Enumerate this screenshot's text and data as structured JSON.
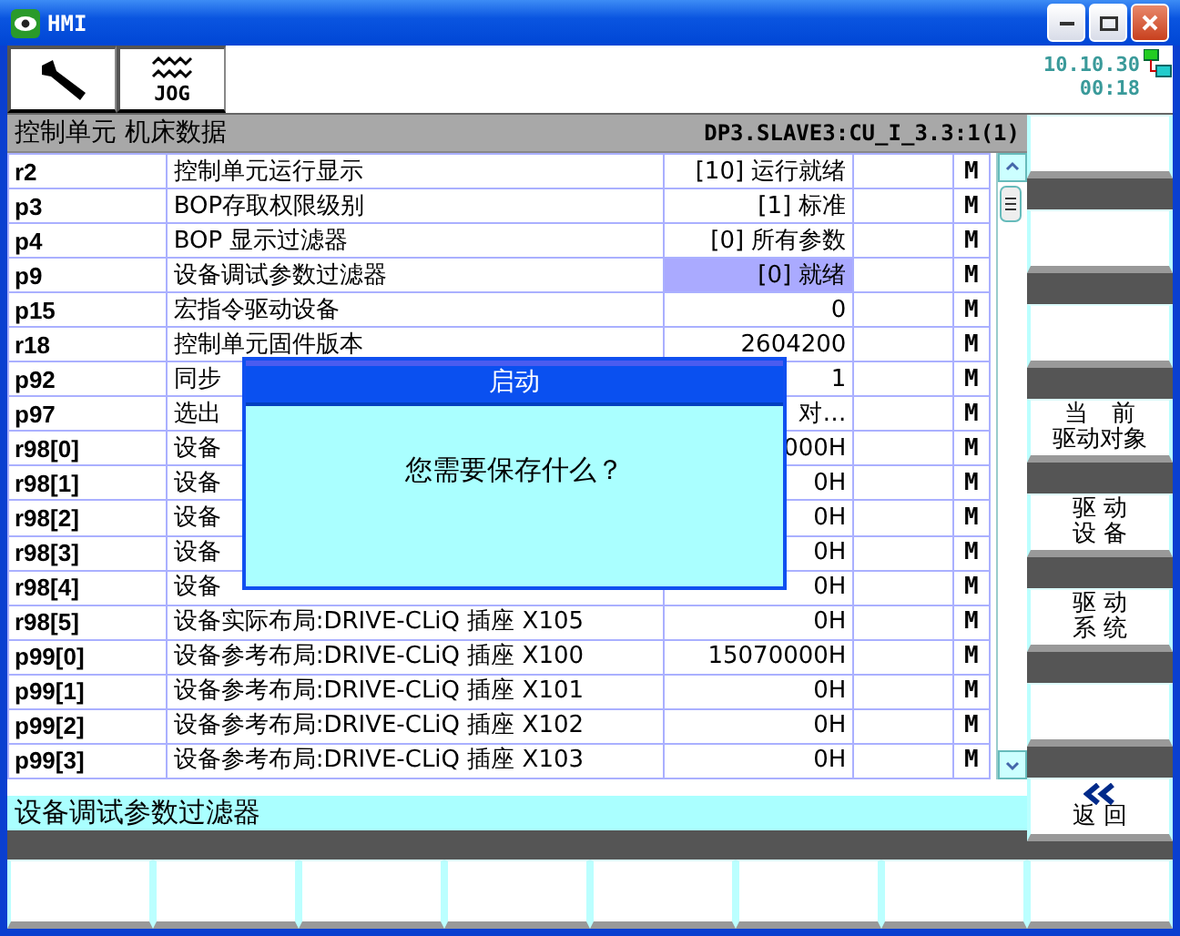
{
  "window": {
    "title": "HMI"
  },
  "toolbar": {
    "jog_label": "JOG",
    "date": "10.10.30",
    "time": "00:18"
  },
  "header": {
    "title": "控制单元 机床数据",
    "path": "DP3.SLAVE3:CU_I_3.3:1(1)"
  },
  "table": {
    "rows": [
      {
        "id": "r2",
        "name": "控制单元运行显示",
        "value": "[10] 运行就绪",
        "flag": "M",
        "selected": false
      },
      {
        "id": "p3",
        "name": "BOP存取权限级别",
        "value": "[1] 标准",
        "flag": "M",
        "selected": false
      },
      {
        "id": "p4",
        "name": "BOP 显示过滤器",
        "value": "[0] 所有参数",
        "flag": "M",
        "selected": false
      },
      {
        "id": "p9",
        "name": "设备调试参数过滤器",
        "value": "[0] 就绪",
        "flag": "M",
        "selected": true
      },
      {
        "id": "p15",
        "name": "宏指令驱动设备",
        "value": "0",
        "flag": "M",
        "selected": false
      },
      {
        "id": "r18",
        "name": "控制单元固件版本",
        "value": "2604200",
        "flag": "M",
        "selected": false
      },
      {
        "id": "p92",
        "name": "同步",
        "value": "1",
        "flag": "M",
        "selected": false
      },
      {
        "id": "p97",
        "name": "选出",
        "value": "对…",
        "flag": "M",
        "selected": false
      },
      {
        "id": "r98[0]",
        "name": "设备",
        "value": "000H",
        "flag": "M",
        "selected": false
      },
      {
        "id": "r98[1]",
        "name": "设备",
        "value": "0H",
        "flag": "M",
        "selected": false
      },
      {
        "id": "r98[2]",
        "name": "设备",
        "value": "0H",
        "flag": "M",
        "selected": false
      },
      {
        "id": "r98[3]",
        "name": "设备",
        "value": "0H",
        "flag": "M",
        "selected": false
      },
      {
        "id": "r98[4]",
        "name": "设备",
        "value": "0H",
        "flag": "M",
        "selected": false
      },
      {
        "id": "r98[5]",
        "name": "设备实际布局:DRIVE-CLiQ 插座 X105",
        "value": "0H",
        "flag": "M",
        "selected": false
      },
      {
        "id": "p99[0]",
        "name": "设备参考布局:DRIVE-CLiQ 插座 X100",
        "value": "15070000H",
        "flag": "M",
        "selected": false
      },
      {
        "id": "p99[1]",
        "name": "设备参考布局:DRIVE-CLiQ 插座 X101",
        "value": "0H",
        "flag": "M",
        "selected": false
      },
      {
        "id": "p99[2]",
        "name": "设备参考布局:DRIVE-CLiQ 插座 X102",
        "value": "0H",
        "flag": "M",
        "selected": false
      },
      {
        "id": "p99[3]",
        "name": "设备参考布局:DRIVE-CLiQ 插座 X103",
        "value": "0H",
        "flag": "M",
        "selected": false
      }
    ]
  },
  "dialog": {
    "title": "启动",
    "message": "您需要保存什么？"
  },
  "status_line": "设备调试参数过滤器",
  "right_softkeys": [
    {
      "kind": "blank"
    },
    {
      "kind": "blank"
    },
    {
      "kind": "blank"
    },
    {
      "kind": "label",
      "lines": [
        "当　前",
        "驱动对象"
      ]
    },
    {
      "kind": "label",
      "lines": [
        "驱 动",
        "设 备"
      ]
    },
    {
      "kind": "label",
      "lines": [
        "驱 动",
        "系 统"
      ]
    },
    {
      "kind": "blank"
    },
    {
      "kind": "back",
      "lines": [
        "返 回"
      ]
    }
  ],
  "bottom_softkeys": [
    {
      "kind": "blank"
    },
    {
      "kind": "blank"
    },
    {
      "kind": "blank"
    },
    {
      "kind": "blank"
    },
    {
      "kind": "blank"
    },
    {
      "kind": "blank"
    },
    {
      "kind": "blank"
    },
    {
      "kind": "blank"
    }
  ]
}
